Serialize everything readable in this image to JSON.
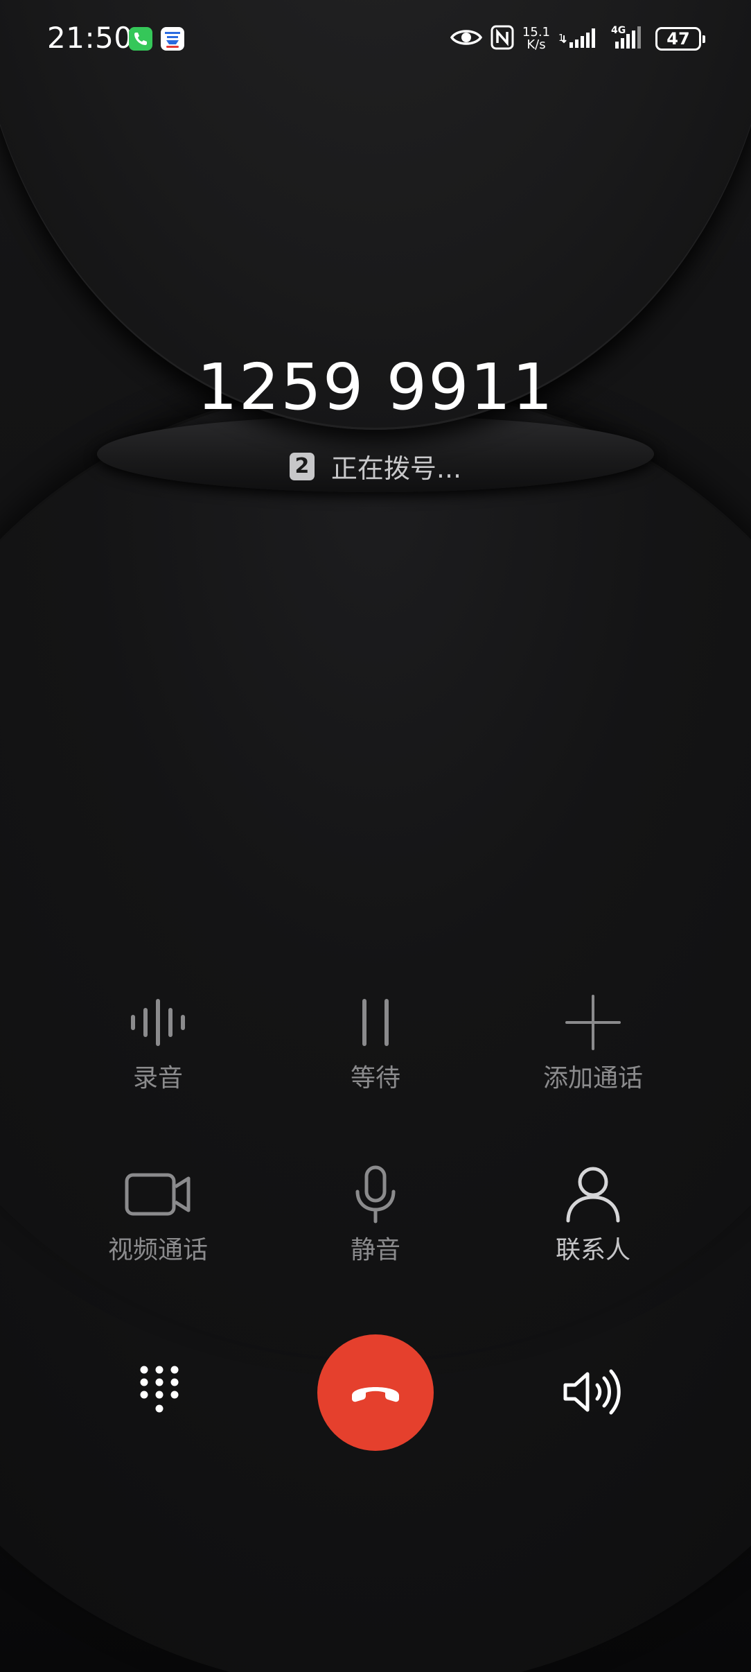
{
  "status_bar": {
    "time": "21:50",
    "speed_value": "15.1",
    "speed_unit": "K/s",
    "network_type": "4G",
    "battery": "47",
    "icons": [
      "phone-app-icon",
      "cloud-app-icon",
      "eye-icon",
      "nfc-icon",
      "signal-icon",
      "signal-4g-icon",
      "battery-icon"
    ]
  },
  "call": {
    "number": "1259 9911",
    "sim_slot": "2",
    "status": "正在拨号..."
  },
  "controls": {
    "record_label": "录音",
    "hold_label": "等待",
    "add_call_label": "添加通话",
    "video_call_label": "视频通话",
    "mute_label": "静音",
    "contacts_label": "联系人"
  },
  "bottom": {
    "icons": [
      "dialpad-icon",
      "end-call-icon",
      "speaker-icon"
    ]
  },
  "colors": {
    "background": "#121213",
    "end_call": "#e5402d",
    "disabled_label": "#8b8b8d",
    "enabled_label": "#c5c5c7"
  }
}
